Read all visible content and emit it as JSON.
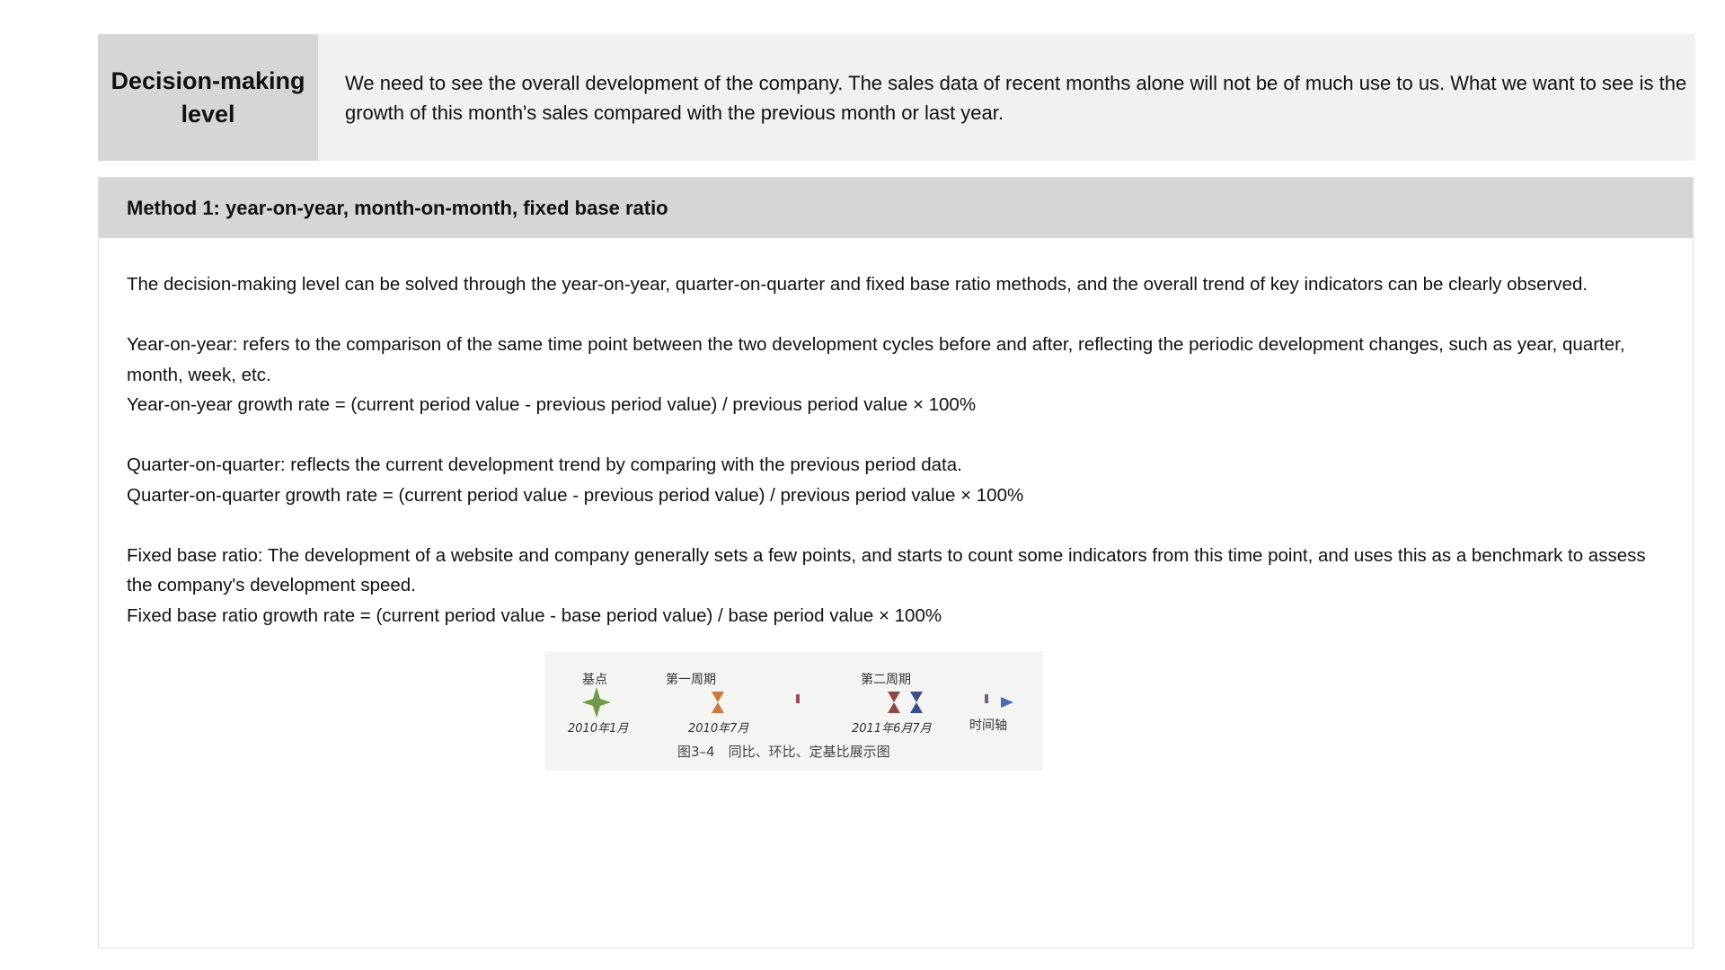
{
  "decision_level": {
    "label": "Decision-making level",
    "description": "We need to see the overall development of the company. The sales data of recent months alone will not be of much use to us. What we want to see is the growth of this month's sales compared with the previous month or last year."
  },
  "method": {
    "title": "Method 1: year-on-year, month-on-month, fixed base ratio",
    "intro": "The decision-making level can be solved through the year-on-year, quarter-on-quarter and fixed base ratio methods, and the overall trend of key indicators can be clearly observed.",
    "yoy_definition": "Year-on-year: refers to the comparison of the same time point between the two development cycles before and after, reflecting the periodic development changes, such as year, quarter, month, week, etc.",
    "yoy_formula": "Year-on-year growth rate = (current period value - previous period value) / previous period value × 100%",
    "qoq_definition": "Quarter-on-quarter: reflects the current development trend by comparing with the previous period data.",
    "qoq_formula": "Quarter-on-quarter growth rate = (current period value - previous period value) / previous period value × 100%",
    "fbr_definition": "Fixed base ratio: The development of a website and company generally sets a few points, and starts to count some indicators from this time point, and uses this as a benchmark to assess the company's development speed.",
    "fbr_formula": "Fixed base ratio growth rate = (current period value - base period value) / base period value × 100%"
  },
  "timeline_figure": {
    "label_base": "基点",
    "label_period1": "第一周期",
    "label_period2": "第二周期",
    "date_1": "2010年1月",
    "date_2": "2010年7月",
    "date_3": "2011年6月7月",
    "axis_label": "时间轴",
    "caption": "图3–4　同比、环比、定基比展示图",
    "colors": {
      "base_star": "#6f9a45",
      "period1_marker": "#c97a3c",
      "period2_marker_a": "#8a4a4a",
      "period2_marker_b": "#3b4f8a",
      "axis_start": "#c8a04a",
      "axis_mid": "#a04a5a",
      "axis_end": "#4a6fb0"
    }
  }
}
